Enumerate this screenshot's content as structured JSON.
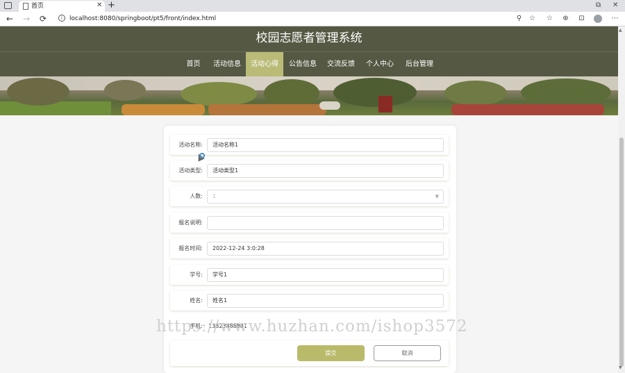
{
  "browser": {
    "tab_title": "首页",
    "tab_close": "✕",
    "new_tab": "+",
    "url": "localhost:8080/springboot/pt5/front/index.html",
    "nav": {
      "back": "←",
      "forward": "→",
      "reload": "⟳"
    },
    "window_controls": {
      "restore": "⧉",
      "close": "✕"
    },
    "toolbar_icons": [
      "⚲",
      "☆",
      "☆",
      "⊕",
      "⊡",
      "⋯"
    ]
  },
  "site": {
    "title": "校园志愿者管理系统",
    "nav_items": [
      "首页",
      "活动信息",
      "活动心得",
      "公告信息",
      "交流反馈",
      "个人中心",
      "后台管理"
    ],
    "active_nav": "活动心得"
  },
  "form": {
    "fields": [
      {
        "label": "活动名称:",
        "value": "活动名称1"
      },
      {
        "label": "活动类型:",
        "value": "活动类型1"
      },
      {
        "label": "人数:",
        "value": "1"
      },
      {
        "label": "报名说明:",
        "value": ""
      },
      {
        "label": "报名时间:",
        "value": "2022-12-24 3:0:28"
      },
      {
        "label": "学号:",
        "value": "学号1"
      },
      {
        "label": "姓名:",
        "value": "姓名1"
      },
      {
        "label": "手机:",
        "value": "13823888881"
      }
    ],
    "submit_label": "提交",
    "cancel_label": "取消"
  },
  "watermark": "https://www.huzhan.com/ishop3572",
  "colors": {
    "header": "#555843",
    "accent": "#b9bb77",
    "submit": "#b9bb6b"
  }
}
